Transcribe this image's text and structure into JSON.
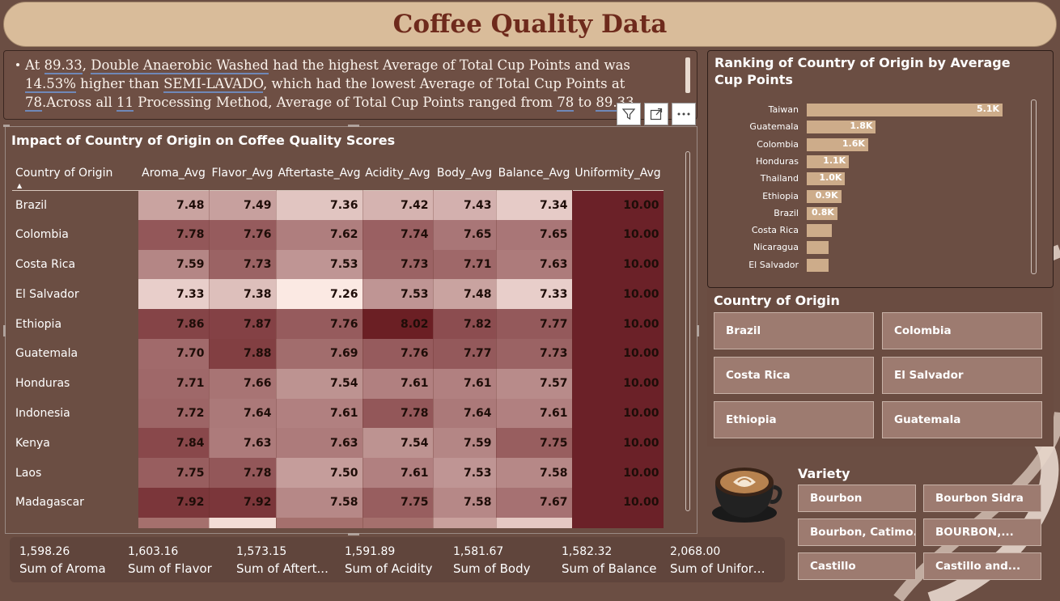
{
  "title": "Coffee Quality Data",
  "narrative": {
    "p1": "At ",
    "v1": "89.33",
    "p2": ", ",
    "v2": "Double Anaerobic Washed",
    "p3": " had the highest Average of Total Cup Points and was ",
    "v3": "14.53%",
    "p4": " higher than ",
    "v4": "SEMI-LAVADO",
    "p5": ", which had the lowest Average of Total Cup Points at ",
    "v5": "78",
    "p6": ".Across all ",
    "v6": "11",
    "p7": " Processing Method, Average of Total Cup Points ranged from ",
    "v7": "78",
    "p8": " to ",
    "v8": "89.33",
    "p9": "."
  },
  "matrix": {
    "title": "Impact of Country of Origin on Coffee Quality Scores",
    "columns": [
      "Country of Origin",
      "Aroma_Avg",
      "Flavor_Avg",
      "Aftertaste_Avg",
      "Acidity_Avg",
      "Body_Avg",
      "Balance_Avg",
      "Uniformity_Avg"
    ],
    "rows": [
      {
        "country": "Brazil",
        "values": [
          "7.48",
          "7.49",
          "7.36",
          "7.42",
          "7.43",
          "7.34",
          "10.00"
        ]
      },
      {
        "country": "Colombia",
        "values": [
          "7.78",
          "7.76",
          "7.62",
          "7.74",
          "7.65",
          "7.65",
          "10.00"
        ]
      },
      {
        "country": "Costa Rica",
        "values": [
          "7.59",
          "7.73",
          "7.53",
          "7.73",
          "7.71",
          "7.63",
          "10.00"
        ]
      },
      {
        "country": "El Salvador",
        "values": [
          "7.33",
          "7.38",
          "7.26",
          "7.53",
          "7.48",
          "7.33",
          "10.00"
        ]
      },
      {
        "country": "Ethiopia",
        "values": [
          "7.86",
          "7.87",
          "7.76",
          "8.02",
          "7.82",
          "7.77",
          "10.00"
        ]
      },
      {
        "country": "Guatemala",
        "values": [
          "7.70",
          "7.88",
          "7.69",
          "7.76",
          "7.77",
          "7.73",
          "10.00"
        ]
      },
      {
        "country": "Honduras",
        "values": [
          "7.71",
          "7.66",
          "7.54",
          "7.61",
          "7.61",
          "7.57",
          "10.00"
        ]
      },
      {
        "country": "Indonesia",
        "values": [
          "7.72",
          "7.64",
          "7.61",
          "7.78",
          "7.64",
          "7.61",
          "10.00"
        ]
      },
      {
        "country": "Kenya",
        "values": [
          "7.84",
          "7.63",
          "7.63",
          "7.54",
          "7.59",
          "7.75",
          "10.00"
        ]
      },
      {
        "country": "Laos",
        "values": [
          "7.75",
          "7.78",
          "7.50",
          "7.61",
          "7.53",
          "7.58",
          "10.00"
        ]
      },
      {
        "country": "Madagascar",
        "values": [
          "7.92",
          "7.92",
          "7.58",
          "7.75",
          "7.58",
          "7.67",
          "10.00"
        ]
      }
    ]
  },
  "totals": [
    {
      "value": "1,598.26",
      "label": "Sum of Aroma"
    },
    {
      "value": "1,603.16",
      "label": "Sum of Flavor"
    },
    {
      "value": "1,573.15",
      "label": "Sum of Aftert..."
    },
    {
      "value": "1,591.89",
      "label": "Sum of Acidity"
    },
    {
      "value": "1,581.67",
      "label": "Sum of Body"
    },
    {
      "value": "1,582.32",
      "label": "Sum of Balance"
    },
    {
      "value": "2,068.00",
      "label": "Sum of Uniformity"
    }
  ],
  "chart_data": {
    "type": "bar",
    "orientation": "horizontal",
    "title": "Ranking of Country of Origin by Average Cup Points",
    "categories": [
      "Taiwan",
      "Guatemala",
      "Colombia",
      "Honduras",
      "Thailand",
      "Ethiopia",
      "Brazil",
      "Costa Rica",
      "Nicaragua",
      "El Salvador"
    ],
    "values": [
      5100,
      1800,
      1600,
      1100,
      1000,
      900,
      800,
      650,
      560,
      560
    ],
    "data_labels": [
      "5.1K",
      "1.8K",
      "1.6K",
      "1.1K",
      "1.0K",
      "0.9K",
      "0.8K",
      "",
      "",
      ""
    ],
    "xlim": [
      0,
      5100
    ],
    "bar_color": "#cdac8a"
  },
  "country_slicer": {
    "title": "Country of Origin",
    "items": [
      "Brazil",
      "Colombia",
      "Costa Rica",
      "El Salvador",
      "Ethiopia",
      "Guatemala"
    ]
  },
  "variety_slicer": {
    "title": "Variety",
    "items": [
      "Bourbon",
      "Bourbon Sidra",
      "Bourbon, Catimo...",
      "BOURBON,...",
      "Castillo",
      "Castillo and..."
    ]
  },
  "colors": {
    "background": "#6b4e43",
    "title_bar": "#d9bc9a",
    "title_text": "#6e2a1c",
    "heat_low": "#fbe9e3",
    "heat_high": "#6b1f24",
    "bar": "#cdac8a"
  },
  "icons": {
    "filter": "filter-icon",
    "focus": "focus-mode-icon",
    "more": "more-options-icon",
    "sort": "sort-ascending-icon"
  }
}
